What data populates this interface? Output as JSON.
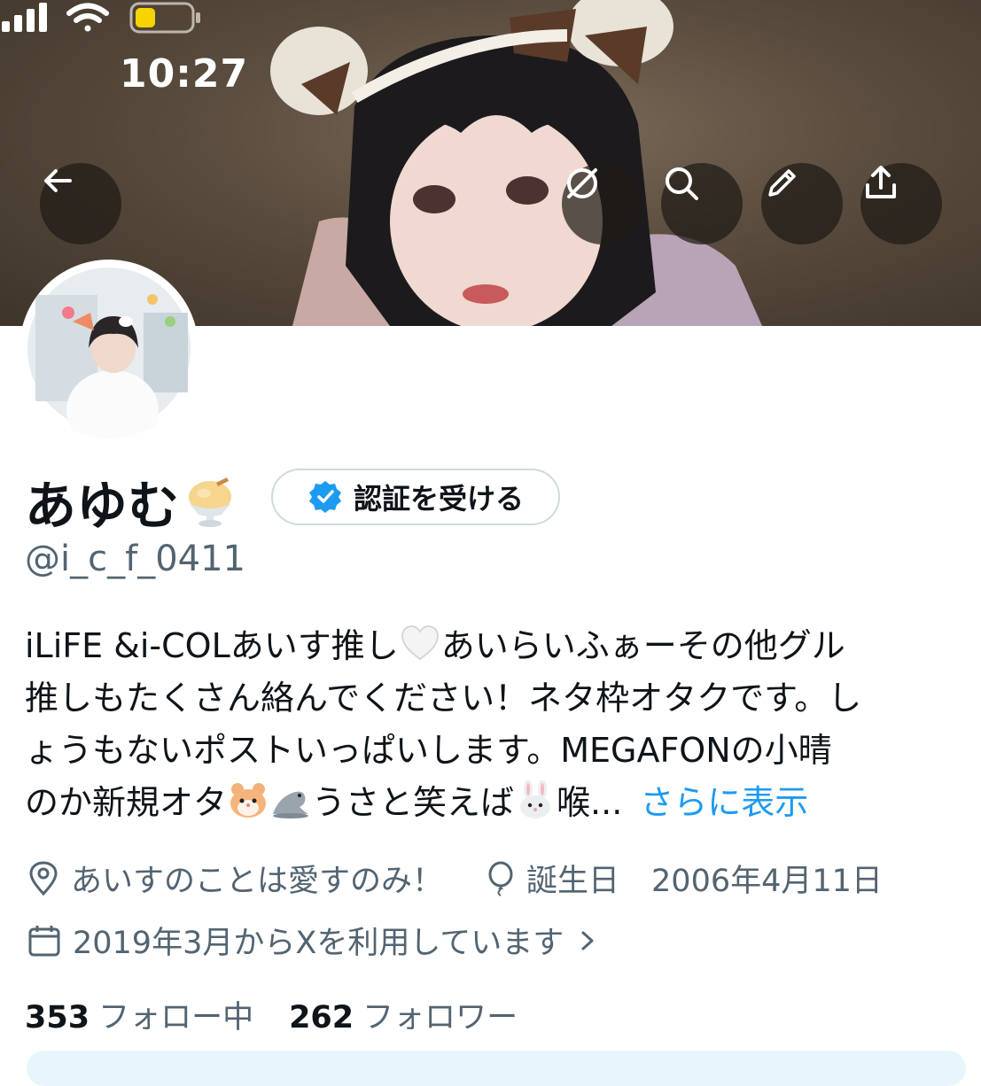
{
  "status_bar": {
    "time": "10:27",
    "icons": [
      "signal-icon",
      "wifi-icon",
      "battery-icon"
    ],
    "battery_color": "#f5d400"
  },
  "header": {
    "buttons": [
      {
        "name": "back-button",
        "icon": "arrow-left-icon"
      },
      {
        "name": "grok-button",
        "icon": "grok-icon"
      },
      {
        "name": "search-button",
        "icon": "search-icon"
      },
      {
        "name": "edit-button",
        "icon": "pencil-icon"
      },
      {
        "name": "share-button",
        "icon": "share-icon"
      }
    ]
  },
  "profile": {
    "display_name": "あゆむ",
    "display_name_emoji": "ice-cream-emoji",
    "verify_button_label": "認証を受ける",
    "handle": "@i_c_f_0411",
    "bio_lines": [
      "iLiFE &i-COLあいす推し",
      "あいらいふぁーその他グル",
      "推しもたくさん絡んでください！ネタ枠オタクです。し",
      "ょうもないポストいっぱいします。MEGAFONの小晴",
      "のか新規オタ",
      "うさと笑えば",
      "喉..."
    ],
    "bio_emojis": [
      "white-heart-emoji",
      "hamster-emoji",
      "seal-emoji",
      "rabbit-emoji"
    ],
    "show_more_label": "さらに表示",
    "location": "あいすのことは愛すのみ！",
    "birthday_label": "誕生日",
    "birthday_value": "2006年4月11日",
    "joined": "2019年3月からXを利用しています",
    "following_count": "353",
    "following_label": "フォロー中",
    "followers_count": "262",
    "followers_label": "フォロワー"
  },
  "colors": {
    "accent": "#1d9bf0",
    "secondary_text": "#536471",
    "primary_text": "#0f1419"
  }
}
